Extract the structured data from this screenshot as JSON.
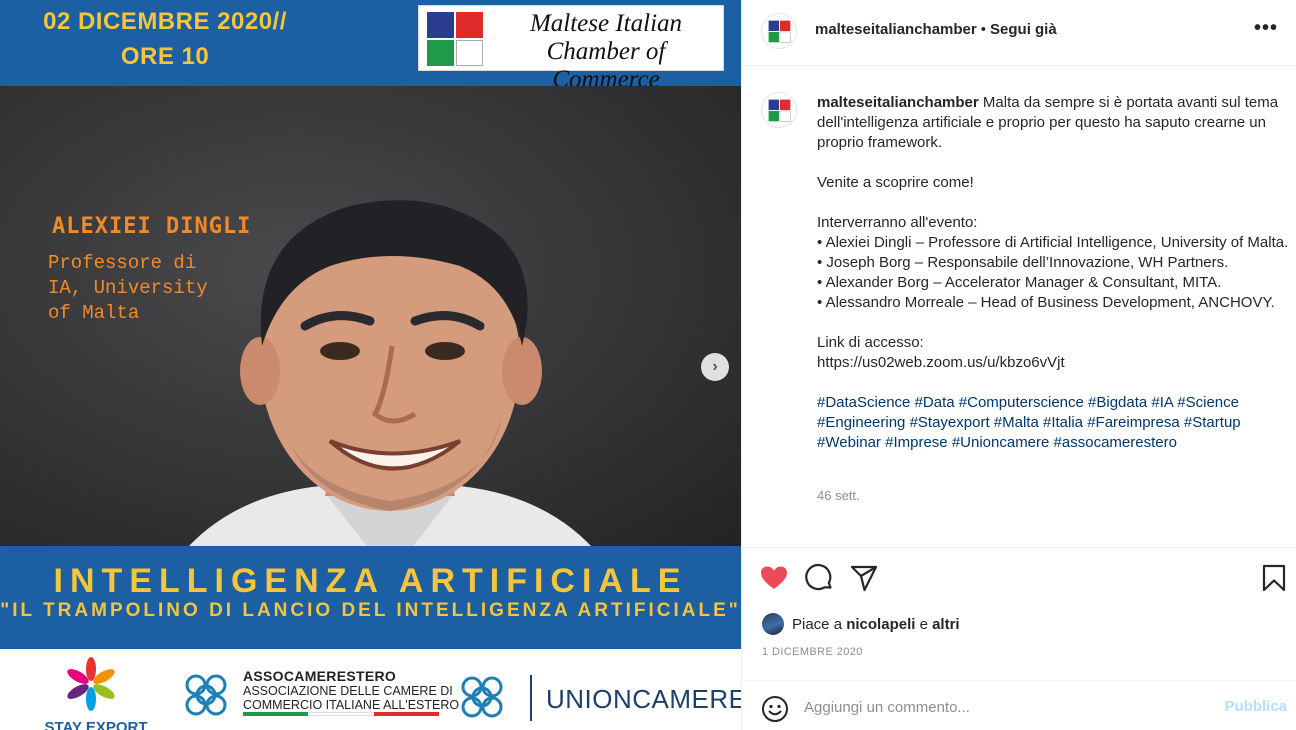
{
  "image": {
    "date_line1": "02 DICEMBRE 2020//",
    "date_line2": "ORE 10",
    "chamber_logo_line1": "Maltese Italian",
    "chamber_logo_line2": "Chamber of Commerce",
    "speaker_name": "ALEXIEI DINGLI",
    "speaker_role": "Professore di\nIA, University\nof Malta",
    "banner_title": "INTELLIGENZA ARTIFICIALE",
    "banner_subtitle": "\"IL TRAMPOLINO DI LANCIO DEL INTELLIGENZA ARTIFICIALE\"",
    "logo_stay_export": "STAY EXPORT",
    "logo_assoc_title": "ASSOCAMERESTERO",
    "logo_assoc_sub": "ASSOCIAZIONE DELLE CAMERE DI\nCOMMERCIO ITALIANE ALL'ESTERO",
    "logo_unioncamere": "UNIONCAMERE",
    "carousel_next_icon": "chevron-right-icon"
  },
  "header": {
    "username": "malteseitalianchamber",
    "separator": "•",
    "follow_label": "Segui già",
    "more_icon": "more-horizontal-icon",
    "more_label": "•••"
  },
  "caption": {
    "username": "malteseitalianchamber",
    "intro": "Malta da sempre si è portata avanti sul tema dell'intelligenza artificiale e proprio per questo ha saputo crearne un proprio framework.",
    "cta": "Venite a scoprire come!",
    "speakers_intro": "Interverranno all'evento:",
    "speakers": [
      "• Alexiei Dingli – Professore di Artificial Intelligence, University of Malta.",
      "• Joseph Borg – Responsabile dell’Innovazione, WH Partners.",
      "• Alexander Borg – Accelerator Manager & Consultant, MITA.",
      "• Alessandro Morreale – Head of Business Development, ANCHOVY."
    ],
    "link_label": "Link di accesso:",
    "link_url": "https://us02web.zoom.us/u/kbzo6vVjt",
    "hashtags": [
      "#DataScience",
      "#Data",
      "#Computerscience",
      "#Bigdata",
      "#IA",
      "#Science",
      "#Engineering",
      "#Stayexport",
      "#Malta",
      "#Italia",
      "#Fareimpresa",
      "#Startup",
      "#Webinar",
      "#Imprese",
      "#Unioncamere",
      "#assocamerestero"
    ],
    "time_ago": "46 sett."
  },
  "actions": {
    "like_icon": "heart-filled-icon",
    "comment_icon": "comment-icon",
    "share_icon": "send-icon",
    "save_icon": "bookmark-icon",
    "likes_prefix": "Piace a",
    "likes_user": "nicolapeli",
    "likes_and": "e",
    "likes_others": "altri",
    "post_date": "1 DICEMBRE 2020"
  },
  "comment": {
    "emoji_icon": "emoji-icon",
    "placeholder": "Aggiungi un commento...",
    "value": "",
    "publish_label": "Pubblica"
  },
  "colors": {
    "accent_blue": "#1c5fa3",
    "accent_yellow": "#f4c53d",
    "speaker_orange": "#f28a2a",
    "like_red": "#ed4956",
    "hashtag_blue": "#00376b",
    "publish_disabled": "#b2dffc"
  }
}
